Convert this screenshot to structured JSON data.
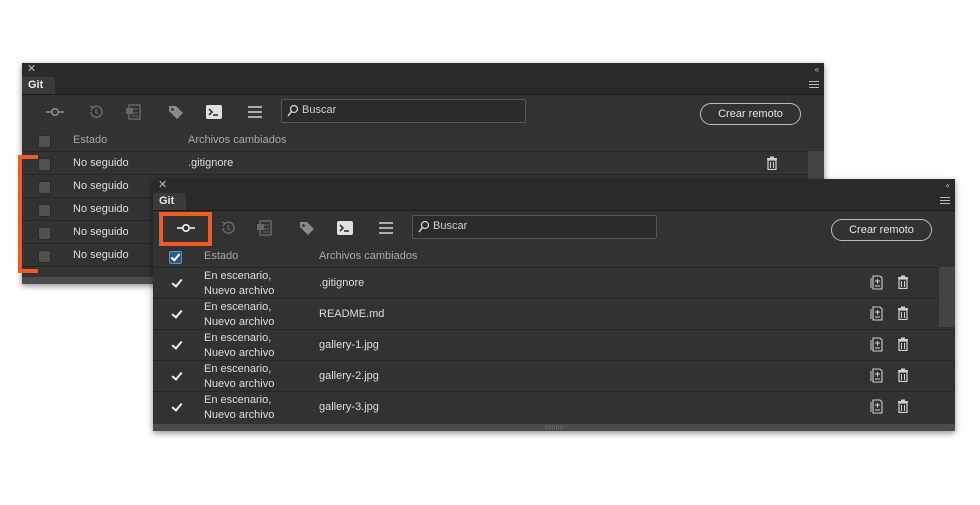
{
  "back_panel": {
    "tab_label": "Git",
    "search_placeholder": "Buscar",
    "crear_remoto_label": "Crear remoto",
    "columns": {
      "estado": "Estado",
      "archivos": "Archivos cambiados"
    },
    "rows": [
      {
        "estado": "No seguido",
        "archivo": ".gitignore"
      },
      {
        "estado": "No seguido",
        "archivo": ""
      },
      {
        "estado": "No seguido",
        "archivo": ""
      },
      {
        "estado": "No seguido",
        "archivo": ""
      },
      {
        "estado": "No seguido",
        "archivo": ""
      }
    ]
  },
  "front_panel": {
    "tab_label": "Git",
    "search_placeholder": "Buscar",
    "crear_remoto_label": "Crear remoto",
    "columns": {
      "estado": "Estado",
      "archivos": "Archivos cambiados"
    },
    "rows": [
      {
        "estado_1": "En escenario,",
        "estado_2": "Nuevo archivo",
        "archivo": ".gitignore"
      },
      {
        "estado_1": "En escenario,",
        "estado_2": "Nuevo archivo",
        "archivo": "README.md"
      },
      {
        "estado_1": "En escenario,",
        "estado_2": "Nuevo archivo",
        "archivo": "gallery-1.jpg"
      },
      {
        "estado_1": "En escenario,",
        "estado_2": "Nuevo archivo",
        "archivo": "gallery-2.jpg"
      },
      {
        "estado_1": "En escenario,",
        "estado_2": "Nuevo archivo",
        "archivo": "gallery-3.jpg"
      }
    ]
  },
  "colors": {
    "highlight": "#f05a24",
    "panel_bg": "#323232",
    "checkbox_blue": "#2d5d86"
  },
  "icons": [
    "close-icon",
    "collapse-icon",
    "panel-menu-icon",
    "commit-icon",
    "history-icon",
    "stash-icon",
    "tag-icon",
    "terminal-icon",
    "list-icon",
    "search-icon",
    "diff-icon",
    "trash-icon"
  ]
}
